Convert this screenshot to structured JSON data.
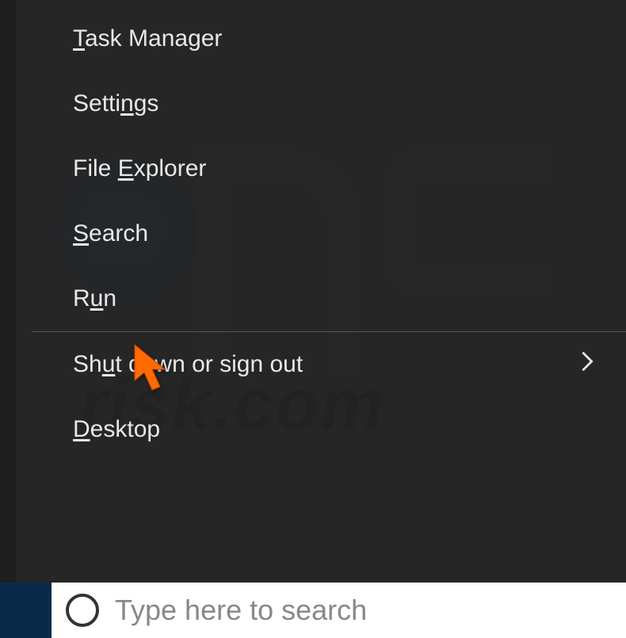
{
  "menu": {
    "items": [
      {
        "before": "",
        "accelerator": "T",
        "after": "ask Manager",
        "has_submenu": false
      },
      {
        "before": "Setti",
        "accelerator": "n",
        "after": "gs",
        "has_submenu": false
      },
      {
        "before": "File ",
        "accelerator": "E",
        "after": "xplorer",
        "has_submenu": false
      },
      {
        "before": "",
        "accelerator": "S",
        "after": "earch",
        "has_submenu": false
      },
      {
        "before": "R",
        "accelerator": "u",
        "after": "n",
        "has_submenu": false
      },
      {
        "before": "Sh",
        "accelerator": "u",
        "after": "t down or sign out",
        "has_submenu": true
      },
      {
        "before": "",
        "accelerator": "D",
        "after": "esktop",
        "has_submenu": false
      }
    ]
  },
  "taskbar": {
    "search_placeholder": "Type here to search"
  },
  "watermark": {
    "text": "risk.com"
  }
}
